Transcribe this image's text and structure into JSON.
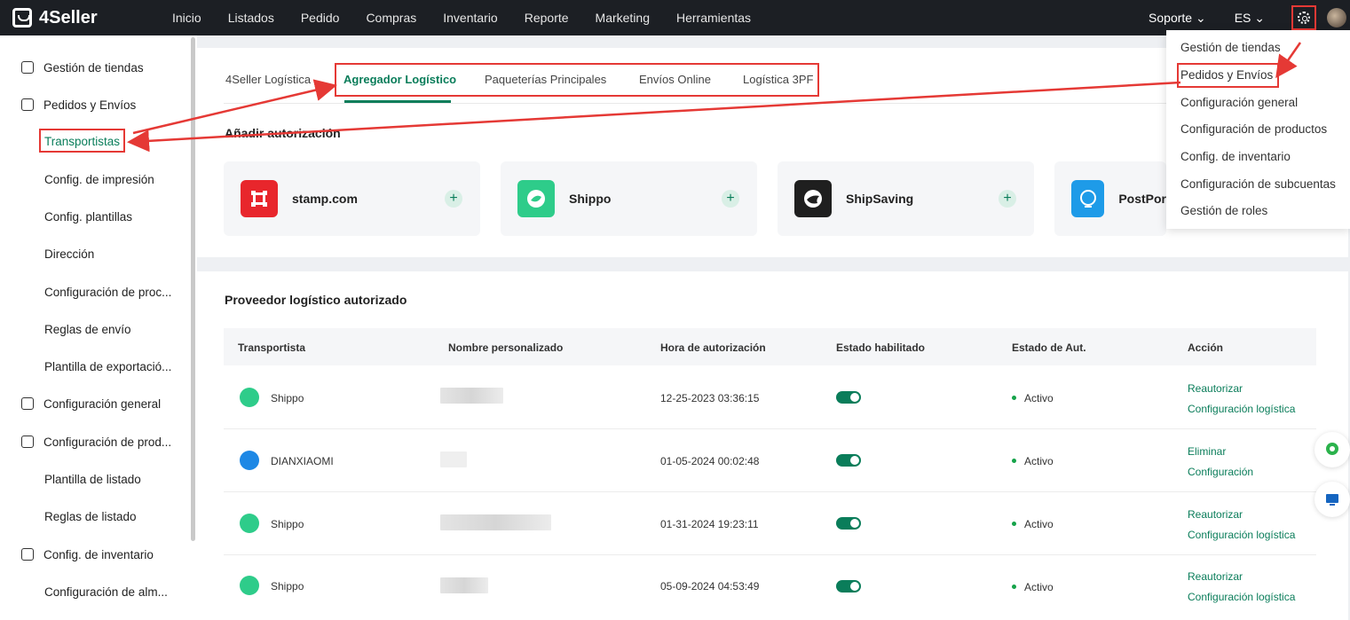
{
  "app": {
    "logo_text": "4Seller"
  },
  "nav": {
    "items": [
      "Inicio",
      "Listados",
      "Pedido",
      "Compras",
      "Inventario",
      "Reporte",
      "Marketing",
      "Herramientas"
    ],
    "support": "Soporte ⌄",
    "language": "ES ⌄"
  },
  "sidebar": {
    "items": [
      {
        "label": "Gestión de tiendas",
        "icon": "store-icon"
      },
      {
        "label": "Pedidos y Envíos",
        "icon": "orders-icon"
      },
      {
        "label": "Transportistas"
      },
      {
        "label": "Config. de impresión"
      },
      {
        "label": "Config. plantillas"
      },
      {
        "label": "Dirección"
      },
      {
        "label": "Configuración de proc..."
      },
      {
        "label": "Reglas de envío"
      },
      {
        "label": "Plantilla de exportació..."
      },
      {
        "label": "Configuración general",
        "icon": "general-settings-icon"
      },
      {
        "label": "Configuración de prod...",
        "icon": "product-settings-icon"
      },
      {
        "label": "Plantilla de listado"
      },
      {
        "label": "Reglas de listado"
      },
      {
        "label": "Config. de inventario",
        "icon": "inventory-icon"
      },
      {
        "label": "Configuración de alm..."
      }
    ]
  },
  "tabs": [
    "4Seller Logística",
    "Agregador Logístico",
    "Paqueterías Principales",
    "Envíos Online",
    "Logística 3PF"
  ],
  "authorize": {
    "title": "Añadir autorización",
    "cards": [
      {
        "name": "stamp.com",
        "color": "#e8262c"
      },
      {
        "name": "Shippo",
        "color": "#2ecc8a"
      },
      {
        "name": "ShipSaving",
        "color": "#1f1f1f"
      },
      {
        "name": "PostPor",
        "color": "#1e9be8"
      }
    ]
  },
  "authorized": {
    "title": "Proveedor logístico autorizado",
    "headers": [
      "Transportista",
      "Nombre personalizado",
      "Hora de autorización",
      "Estado habilitado",
      "Estado de Aut.",
      "Acción"
    ],
    "rows": [
      {
        "carrier": "Shippo",
        "time": "12-25-2023 03:36:15",
        "status": "Activo",
        "action1": "Reautorizar",
        "action2": "Configuración logística"
      },
      {
        "carrier": "DIANXIAOMI",
        "time": "01-05-2024 00:02:48",
        "status": "Activo",
        "action1": "Eliminar",
        "action2": "Configuración"
      },
      {
        "carrier": "Shippo",
        "time": "01-31-2024 19:23:11",
        "status": "Activo",
        "action1": "Reautorizar",
        "action2": "Configuración logística"
      },
      {
        "carrier": "Shippo",
        "time": "05-09-2024 04:53:49",
        "status": "Activo",
        "action1": "Reautorizar",
        "action2": "Configuración logística"
      }
    ]
  },
  "settings_menu": {
    "items": [
      "Gestión de tiendas",
      "Pedidos y Envíos",
      "Configuración general",
      "Configuración de productos",
      "Config. de inventario",
      "Configuración de subcuentas",
      "Gestión de roles"
    ]
  },
  "colors": {
    "accent": "#0a7d5a",
    "highlight": "#e53935",
    "topbar": "#1c1f24"
  }
}
